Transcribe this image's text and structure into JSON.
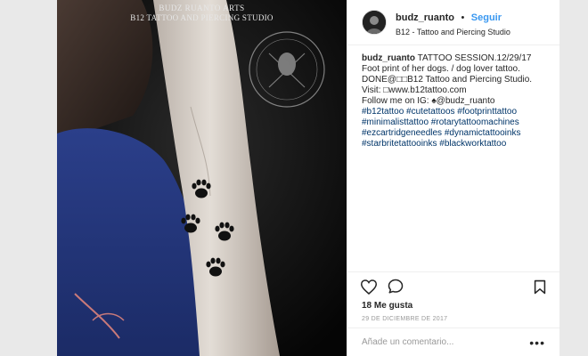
{
  "photo": {
    "watermark_line1": "BUDZ RUANTO ARTS",
    "watermark_line2": "B12 TATTOO AND PIERCING STUDIO",
    "alt_subject": "forearm tattoo of four paw prints"
  },
  "header": {
    "username": "budz_ruanto",
    "separator": "•",
    "follow_label": "Seguir",
    "location": "B12 - Tattoo and Piercing Studio"
  },
  "caption": {
    "username": "budz_ruanto",
    "lines": [
      "TATTOO SESSION.12/29/17",
      "Foot print of her dogs. / dog lover tattoo.",
      "DONE@□□B12 Tattoo and Piercing Studio.",
      "Visit: □www.b12tattoo.com",
      "Follow me on IG: ♠@budz_ruanto"
    ],
    "hashtag_lines": [
      "#b12tattoo #cutetattoos #footprinttattoo",
      "#minimalisttattoo #rotarytattoomachines",
      "#ezcartridgeneedles #dynamictattooinks",
      "#starbritetattooinks #blackworktattoo"
    ]
  },
  "actions": {
    "like_icon": "heart-icon",
    "comment_icon": "comment-icon",
    "save_icon": "bookmark-icon"
  },
  "likes_label": "18 Me gusta",
  "date_label": "29 DE DICIEMBRE DE 2017",
  "comment_box": {
    "placeholder": "Añade un comentario...",
    "more_label": "•••"
  },
  "colors": {
    "link_blue": "#3897f0",
    "hashtag": "#003569",
    "background": "#e9e9e9"
  }
}
